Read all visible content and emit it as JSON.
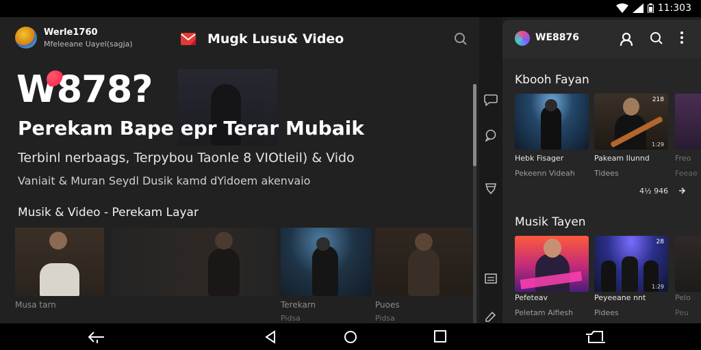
{
  "status": {
    "time": "11:303"
  },
  "app": {
    "name": "Werle1760",
    "subtitle": "Mfeleeane Uayel(sagja)",
    "title": "Mugk Lusu& Video"
  },
  "hero": {
    "logo": "W878?",
    "headline": "Perekam Bape epr Terar Mubaik",
    "subline1": "Terbinl nerbaags, Terpybou Taonle 8 VIOtleil) & Vido",
    "subline2": "Vaniait & Muran Seydl Dusik kamd dYidoem akenvaio"
  },
  "left_section": {
    "title": "Musik & Video - Perekam Layar",
    "items": [
      {
        "caption": "Musa tarn",
        "sub": ""
      },
      {
        "caption": "",
        "sub": ""
      },
      {
        "caption": "Terekarn",
        "sub": "Pidsa"
      },
      {
        "caption": "Puoes",
        "sub": "Pidsa"
      }
    ]
  },
  "right_panel": {
    "title": "WE8876",
    "section1": {
      "title": "Kbooh Fayan",
      "items": [
        {
          "caption": "Hebk Fisager",
          "sub": "Pekeenn Videah",
          "badge": ""
        },
        {
          "caption": "Pakeam Ilunnd",
          "sub": "Tidees",
          "badge": "218",
          "badge2": "1:29"
        },
        {
          "caption": "Freo",
          "sub": "Feeae",
          "badge": ""
        }
      ],
      "more_count": "4½ 946"
    },
    "section2": {
      "title": "Musik Tayen",
      "items": [
        {
          "caption": "Pefeteav",
          "sub": "Peletam Aifiesh",
          "badge": ""
        },
        {
          "caption": "Peyeeane nnt",
          "sub": "Pidees",
          "badge": "28",
          "badge2": "1:29"
        },
        {
          "caption": "Pelo",
          "sub": "Peu",
          "badge": ""
        }
      ]
    }
  },
  "colors": {
    "background": "#1f1f1f",
    "panel": "#262626",
    "accent_red": "#e53935",
    "logo_accent": "#ff2d55"
  }
}
